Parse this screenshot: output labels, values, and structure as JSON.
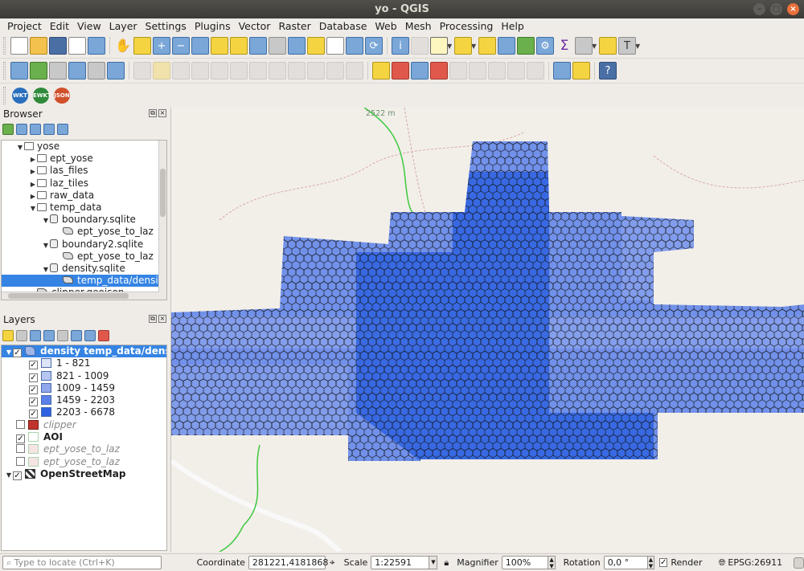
{
  "window": {
    "title": "yo - QGIS"
  },
  "menubar": {
    "items": [
      "Project",
      "Edit",
      "View",
      "Layer",
      "Settings",
      "Plugins",
      "Vector",
      "Raster",
      "Database",
      "Web",
      "Mesh",
      "Processing",
      "Help"
    ]
  },
  "browser": {
    "title": "Browser",
    "items": [
      {
        "label": "yose",
        "depth": 0,
        "expanded": true,
        "kind": "folder"
      },
      {
        "label": "ept_yose",
        "depth": 1,
        "expanded": false,
        "kind": "folder"
      },
      {
        "label": "las_files",
        "depth": 1,
        "expanded": false,
        "kind": "folder"
      },
      {
        "label": "laz_tiles",
        "depth": 1,
        "expanded": false,
        "kind": "folder"
      },
      {
        "label": "raw_data",
        "depth": 1,
        "expanded": false,
        "kind": "folder"
      },
      {
        "label": "temp_data",
        "depth": 1,
        "expanded": true,
        "kind": "folder"
      },
      {
        "label": "boundary.sqlite",
        "depth": 2,
        "expanded": true,
        "kind": "db"
      },
      {
        "label": "ept_yose_to_laz",
        "depth": 3,
        "kind": "poly"
      },
      {
        "label": "boundary2.sqlite",
        "depth": 2,
        "expanded": true,
        "kind": "db"
      },
      {
        "label": "ept_yose_to_laz",
        "depth": 3,
        "kind": "poly"
      },
      {
        "label": "density.sqlite",
        "depth": 2,
        "expanded": true,
        "kind": "db"
      },
      {
        "label": "temp_data/densit",
        "depth": 3,
        "kind": "poly",
        "selected": true
      },
      {
        "label": "clipper.geojson",
        "depth": 1,
        "kind": "poly"
      }
    ]
  },
  "layers": {
    "title": "Layers",
    "items": [
      {
        "label": "density temp_data/density",
        "checked": true,
        "kind": "group",
        "selected": true
      },
      {
        "label": "1 - 821",
        "checked": true,
        "kind": "class",
        "color": "#dfe5f8"
      },
      {
        "label": "821 - 1009",
        "checked": true,
        "kind": "class",
        "color": "#b7c6f0"
      },
      {
        "label": "1009 - 1459",
        "checked": true,
        "kind": "class",
        "color": "#8fa7ec"
      },
      {
        "label": "1459 - 2203",
        "checked": true,
        "kind": "class",
        "color": "#5b80ea"
      },
      {
        "label": "2203 - 6678",
        "checked": true,
        "kind": "class",
        "color": "#2e62e0"
      },
      {
        "label": "clipper",
        "checked": false,
        "kind": "layer",
        "color": "#c0342c",
        "italic": true
      },
      {
        "label": "AOI",
        "checked": true,
        "kind": "layer",
        "color": "#ffffff",
        "bold": true
      },
      {
        "label": "ept_yose_to_laz",
        "checked": false,
        "kind": "layer",
        "color": "#f6e4e4",
        "italic": true
      },
      {
        "label": "ept_yose_to_laz",
        "checked": false,
        "kind": "layer",
        "color": "#f6e4e4",
        "italic": true
      },
      {
        "label": "OpenStreetMap",
        "checked": true,
        "kind": "raster",
        "bold": true
      }
    ]
  },
  "map": {
    "elevation_label": "2522 m"
  },
  "statusbar": {
    "locate_placeholder": "Type to locate (Ctrl+K)",
    "coordinate_label": "Coordinate",
    "coordinate_value": "281221,4181868",
    "scale_label": "Scale",
    "scale_value": "1:22591",
    "magnifier_label": "Magnifier",
    "magnifier_value": "100%",
    "rotation_label": "Rotation",
    "rotation_value": "0,0 °",
    "render_label": "Render",
    "crs_label": "EPSG:26911"
  },
  "toolbar3": {
    "wkt": "WKT",
    "ewkt": "EWKT",
    "json": "JSON"
  },
  "colors": {
    "hex_fill_dark": "#2e62e0",
    "hex_fill_light": "#5b80ea",
    "selection": "#3584e4"
  }
}
